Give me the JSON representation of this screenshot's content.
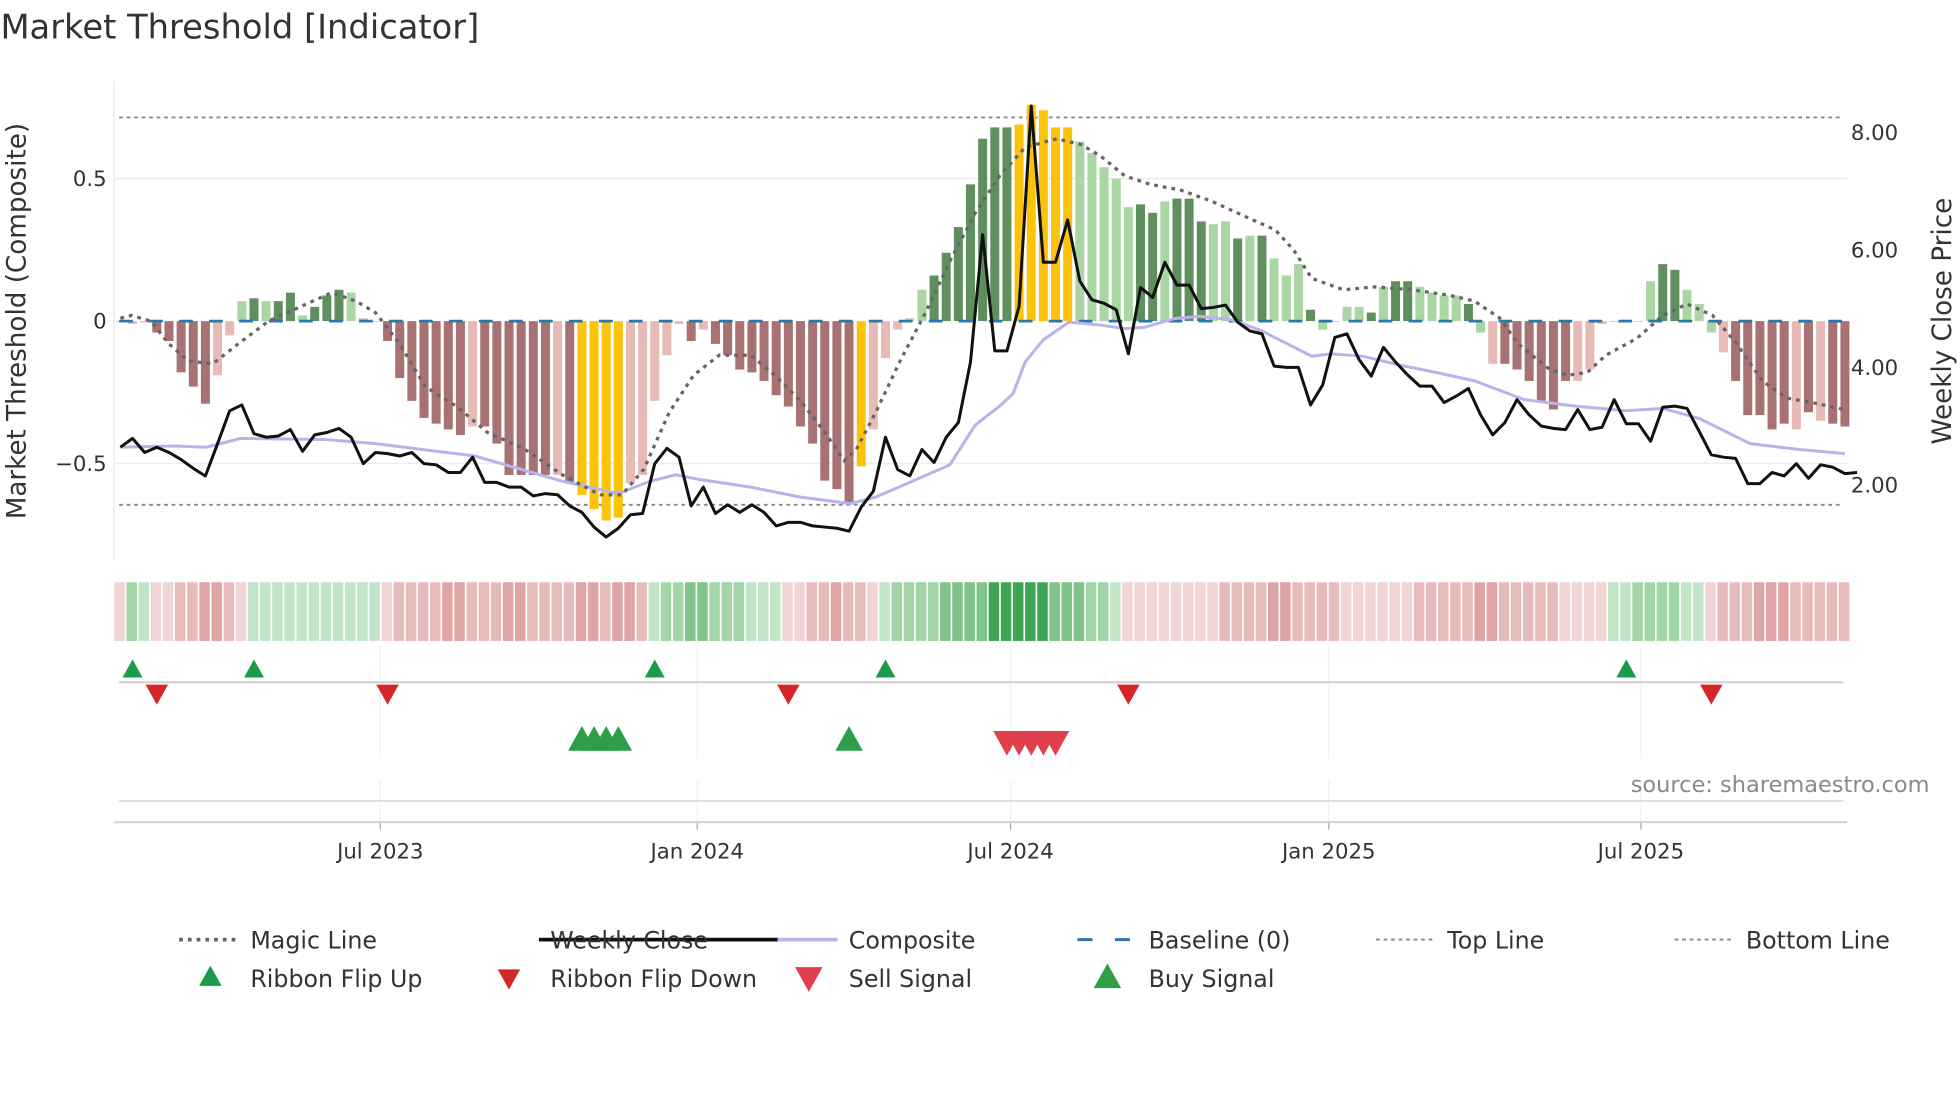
{
  "title": "Market Threshold [Indicator]",
  "source": "source: sharemaestro.com",
  "colors": {
    "G": "#5f8f5f",
    "g": "#a9d6a2",
    "R": "#a87272",
    "r": "#e8bab6",
    "Y": "#fcc30a",
    "magic": "#666666",
    "close": "#111111",
    "composite": "#b9b3ea",
    "baseline": "#2b77a8",
    "threshold": "#888888",
    "flip_up": "#1a9c4a",
    "flip_down": "#d62728",
    "sell": "#e0404e",
    "buy": "#2e9e48"
  },
  "chart_data": {
    "type": "bar",
    "title": "Market Threshold [Indicator]",
    "ylabel_left": "Market Threshold (Composite)",
    "ylabel_right": "Weekly Close Price",
    "ylim_left": [
      -0.85,
      0.8
    ],
    "ylim_right": [
      1.0,
      8.8
    ],
    "left_ticks": [
      {
        "v": 0.5,
        "label": "0.5"
      },
      {
        "v": 0,
        "label": "0"
      },
      {
        "v": -0.5,
        "label": "−0.5"
      }
    ],
    "right_ticks": [
      {
        "v": 8,
        "label": "8.00"
      },
      {
        "v": 6,
        "label": "6.00"
      },
      {
        "v": 4,
        "label": "4.00"
      },
      {
        "v": 2,
        "label": "2.00"
      }
    ],
    "x_ticks": [
      {
        "week": 21.4,
        "label": "Jul 2023"
      },
      {
        "week": 47.5,
        "label": "Jan 2024"
      },
      {
        "week": 73.3,
        "label": "Jul 2024"
      },
      {
        "week": 99.5,
        "label": "Jan 2025"
      },
      {
        "week": 125.2,
        "label": "Jul 2025"
      }
    ],
    "top_line": 0.715,
    "bottom_line": -0.645,
    "baseline": 0,
    "bar_values": [
      0,
      -0.01,
      -0.005,
      -0.04,
      -0.07,
      -0.18,
      -0.23,
      -0.29,
      -0.19,
      -0.05,
      0.07,
      0.08,
      0.07,
      0.07,
      0.1,
      0.02,
      0.05,
      0.09,
      0.11,
      0.1,
      0.01,
      0,
      -0.07,
      -0.2,
      -0.28,
      -0.34,
      -0.36,
      -0.38,
      -0.4,
      -0.37,
      -0.37,
      -0.43,
      -0.54,
      -0.54,
      -0.54,
      -0.54,
      -0.54,
      -0.57,
      -0.61,
      -0.66,
      -0.7,
      -0.69,
      -0.57,
      -0.54,
      -0.28,
      -0.12,
      -0.01,
      -0.07,
      -0.03,
      -0.08,
      -0.12,
      -0.17,
      -0.18,
      -0.21,
      -0.26,
      -0.3,
      -0.37,
      -0.43,
      -0.56,
      -0.59,
      -0.64,
      -0.51,
      -0.38,
      -0.13,
      -0.03,
      0.01,
      0.11,
      0.16,
      0.24,
      0.33,
      0.48,
      0.64,
      0.68,
      0.68,
      0.69,
      0.76,
      0.74,
      0.68,
      0.68,
      0.63,
      0.59,
      0.54,
      0.5,
      0.4,
      0.41,
      0.38,
      0.42,
      0.43,
      0.43,
      0.35,
      0.34,
      0.35,
      0.29,
      0.3,
      0.3,
      0.22,
      0.16,
      0.2,
      0.04,
      -0.03,
      0,
      0.05,
      0.05,
      0.03,
      0.12,
      0.14,
      0.14,
      0.12,
      0.1,
      0.09,
      0.09,
      0.06,
      -0.04,
      -0.15,
      -0.15,
      -0.17,
      -0.21,
      -0.28,
      -0.31,
      -0.21,
      -0.21,
      -0.17,
      -0.01,
      0,
      0.005,
      0,
      0.14,
      0.2,
      0.18,
      0.11,
      0.06,
      -0.04,
      -0.11,
      -0.21,
      -0.33,
      -0.33,
      -0.38,
      -0.36,
      -0.38,
      -0.32,
      -0.35,
      -0.36,
      -0.37
    ],
    "bar_states": "grrRRRRRrrgGgGGgGGGggrRRRRRRRrRRRRRRrRYYYYrrrrrRrRRRRRRRRRRRRYrrrrgGGGGGGGYYYYYgggggGGgGGGggGgGgggGgrggGgGGggggGgrRRRRRRrrrrgggGGgggrRRRRRrRrRRR",
    "weekly_close": [
      2.64,
      2.79,
      2.55,
      2.64,
      2.55,
      2.43,
      2.28,
      2.15,
      2.7,
      3.26,
      3.36,
      2.87,
      2.81,
      2.83,
      2.94,
      2.57,
      2.85,
      2.89,
      2.96,
      2.81,
      2.36,
      2.55,
      2.53,
      2.49,
      2.55,
      2.36,
      2.34,
      2.21,
      2.21,
      2.47,
      2.04,
      2.04,
      1.96,
      1.96,
      1.81,
      1.85,
      1.83,
      1.64,
      1.53,
      1.28,
      1.11,
      1.26,
      1.49,
      1.51,
      2.36,
      2.62,
      2.47,
      1.64,
      1.96,
      1.51,
      1.66,
      1.53,
      1.66,
      1.53,
      1.3,
      1.36,
      1.36,
      1.3,
      1.28,
      1.26,
      1.21,
      1.62,
      1.89,
      2.81,
      2.26,
      2.15,
      2.6,
      2.38,
      2.81,
      3.06,
      4.09,
      6.26,
      4.28,
      4.28,
      5.04,
      8.45,
      5.79,
      5.79,
      6.51,
      5.47,
      5.15,
      5.09,
      4.98,
      4.23,
      5.36,
      5.19,
      5.79,
      5.4,
      5.4,
      5.0,
      5.02,
      5.06,
      4.77,
      4.62,
      4.57,
      4.02,
      4.0,
      4.0,
      3.36,
      3.7,
      4.51,
      4.57,
      4.13,
      3.85,
      4.34,
      4.09,
      3.87,
      3.68,
      3.68,
      3.4,
      3.51,
      3.64,
      3.19,
      2.85,
      3.06,
      3.45,
      3.19,
      3.0,
      2.96,
      2.94,
      3.28,
      2.94,
      2.98,
      3.45,
      3.04,
      3.04,
      2.74,
      3.32,
      3.34,
      3.3,
      2.91,
      2.51,
      2.47,
      2.45,
      2.02,
      2.02,
      2.21,
      2.15,
      2.36,
      2.11,
      2.34,
      2.3,
      2.19,
      2.21
    ],
    "composite": [
      [
        0,
        2.64
      ],
      [
        4.5,
        2.66
      ],
      [
        7.1,
        2.64
      ],
      [
        9.9,
        2.79
      ],
      [
        16.9,
        2.77
      ],
      [
        21,
        2.7
      ],
      [
        29.2,
        2.49
      ],
      [
        36.4,
        2.06
      ],
      [
        41,
        1.85
      ],
      [
        43.6,
        2.06
      ],
      [
        45.7,
        2.17
      ],
      [
        47.7,
        2.09
      ],
      [
        51.9,
        1.96
      ],
      [
        56,
        1.79
      ],
      [
        60.1,
        1.68
      ],
      [
        62.2,
        1.79
      ],
      [
        65.2,
        2.06
      ],
      [
        68.3,
        2.34
      ],
      [
        70.4,
        3.02
      ],
      [
        72.4,
        3.34
      ],
      [
        73.5,
        3.55
      ],
      [
        74.5,
        4.09
      ],
      [
        76,
        4.47
      ],
      [
        78.1,
        4.77
      ],
      [
        80.7,
        4.72
      ],
      [
        82.7,
        4.66
      ],
      [
        84.3,
        4.68
      ],
      [
        86.8,
        4.83
      ],
      [
        88.9,
        4.87
      ],
      [
        91.5,
        4.81
      ],
      [
        94,
        4.62
      ],
      [
        98.1,
        4.19
      ],
      [
        99.7,
        4.23
      ],
      [
        102.3,
        4.19
      ],
      [
        105.3,
        4.04
      ],
      [
        108.4,
        3.91
      ],
      [
        111.5,
        3.77
      ],
      [
        115.6,
        3.45
      ],
      [
        119.8,
        3.34
      ],
      [
        123.9,
        3.26
      ],
      [
        127,
        3.3
      ],
      [
        130,
        3.13
      ],
      [
        134.2,
        2.7
      ],
      [
        138.3,
        2.6
      ],
      [
        142,
        2.53
      ]
    ],
    "magic_line": [
      [
        0,
        0.01
      ],
      [
        0.9,
        0.02
      ],
      [
        2.5,
        0
      ],
      [
        4,
        -0.08
      ],
      [
        5.6,
        -0.14
      ],
      [
        7.6,
        -0.15
      ],
      [
        9.7,
        -0.08
      ],
      [
        12.2,
        0
      ],
      [
        14.8,
        0.05
      ],
      [
        17.4,
        0.1
      ],
      [
        19.4,
        0.07
      ],
      [
        21,
        0.03
      ],
      [
        23,
        -0.08
      ],
      [
        25.1,
        -0.23
      ],
      [
        27.7,
        -0.3
      ],
      [
        30.2,
        -0.39
      ],
      [
        33.3,
        -0.45
      ],
      [
        36.4,
        -0.54
      ],
      [
        39.5,
        -0.61
      ],
      [
        41.3,
        -0.61
      ],
      [
        43.1,
        -0.52
      ],
      [
        45.2,
        -0.32
      ],
      [
        47.2,
        -0.19
      ],
      [
        49.3,
        -0.12
      ],
      [
        51.9,
        -0.12
      ],
      [
        53.9,
        -0.19
      ],
      [
        56,
        -0.28
      ],
      [
        58,
        -0.39
      ],
      [
        59.6,
        -0.49
      ],
      [
        60.6,
        -0.45
      ],
      [
        62.2,
        -0.32
      ],
      [
        64.2,
        -0.14
      ],
      [
        66.3,
        0.03
      ],
      [
        68.3,
        0.21
      ],
      [
        70.4,
        0.38
      ],
      [
        72.4,
        0.51
      ],
      [
        74.5,
        0.61
      ],
      [
        77.1,
        0.64
      ],
      [
        79.1,
        0.62
      ],
      [
        80.7,
        0.58
      ],
      [
        82.7,
        0.51
      ],
      [
        84.8,
        0.48
      ],
      [
        87.3,
        0.46
      ],
      [
        89.9,
        0.42
      ],
      [
        93,
        0.36
      ],
      [
        95.1,
        0.32
      ],
      [
        96.6,
        0.25
      ],
      [
        98.1,
        0.15
      ],
      [
        100.7,
        0.11
      ],
      [
        103.3,
        0.12
      ],
      [
        106.4,
        0.11
      ],
      [
        109.5,
        0.09
      ],
      [
        111.5,
        0.07
      ],
      [
        113.6,
        0.01
      ],
      [
        115.1,
        -0.08
      ],
      [
        117.7,
        -0.17
      ],
      [
        119.2,
        -0.19
      ],
      [
        120.8,
        -0.18
      ],
      [
        122.3,
        -0.12
      ],
      [
        124.9,
        -0.06
      ],
      [
        127,
        0.02
      ],
      [
        129,
        0.06
      ],
      [
        131.1,
        0.02
      ],
      [
        133.1,
        -0.08
      ],
      [
        135.2,
        -0.21
      ],
      [
        137.2,
        -0.27
      ],
      [
        139.8,
        -0.29
      ],
      [
        141.9,
        -0.31
      ]
    ],
    "ribbon_levels": [
      -1,
      2,
      1,
      -1,
      -1,
      -2,
      -2,
      -3,
      -3,
      -2,
      -1,
      1,
      1,
      1,
      1,
      1,
      1,
      1,
      1,
      1,
      1,
      1,
      -1,
      -2,
      -2,
      -2,
      -2,
      -3,
      -3,
      -2,
      -2,
      -2,
      -3,
      -3,
      -2,
      -2,
      -2,
      -2,
      -3,
      -3,
      -2,
      -3,
      -3,
      -2,
      1,
      2,
      2,
      3,
      3,
      2,
      2,
      2,
      1,
      1,
      1,
      -1,
      -1,
      -2,
      -2,
      -3,
      -2,
      -2,
      -1,
      1,
      2,
      2,
      2,
      2,
      3,
      3,
      3,
      3,
      4,
      4,
      4,
      4,
      4,
      3,
      3,
      3,
      2,
      2,
      1,
      -1,
      -1,
      -1,
      -1,
      -1,
      -1,
      -1,
      -1,
      -2,
      -2,
      -2,
      -2,
      -3,
      -3,
      -2,
      -2,
      -2,
      -2,
      -1,
      -1,
      -1,
      -1,
      -1,
      -1,
      -2,
      -2,
      -2,
      -2,
      -2,
      -3,
      -3,
      -2,
      -2,
      -2,
      -2,
      -2,
      -1,
      -1,
      -1,
      -1,
      1,
      1,
      2,
      2,
      2,
      2,
      1,
      1,
      -1,
      -2,
      -2,
      -2,
      -3,
      -3,
      -3,
      -2,
      -2,
      -2,
      -2,
      -2
    ],
    "ribbon_flip_up": [
      1,
      11,
      44,
      63,
      124
    ],
    "ribbon_flip_down": [
      3,
      22,
      55,
      83,
      131
    ],
    "buy_signal": [
      38,
      39,
      40,
      41,
      60
    ],
    "sell_signal": [
      73,
      74,
      75,
      76,
      77
    ],
    "legend": [
      {
        "key": "magic",
        "label": "Magic Line"
      },
      {
        "key": "close",
        "label": "Weekly Close"
      },
      {
        "key": "composite",
        "label": "Composite"
      },
      {
        "key": "baseline",
        "label": "Baseline (0)"
      },
      {
        "key": "top",
        "label": "Top Line"
      },
      {
        "key": "bottom",
        "label": "Bottom Line"
      },
      {
        "key": "flip_up",
        "label": "Ribbon Flip Up"
      },
      {
        "key": "flip_down",
        "label": "Ribbon Flip Down"
      },
      {
        "key": "sell",
        "label": "Sell Signal"
      },
      {
        "key": "buy",
        "label": "Buy Signal"
      }
    ]
  }
}
